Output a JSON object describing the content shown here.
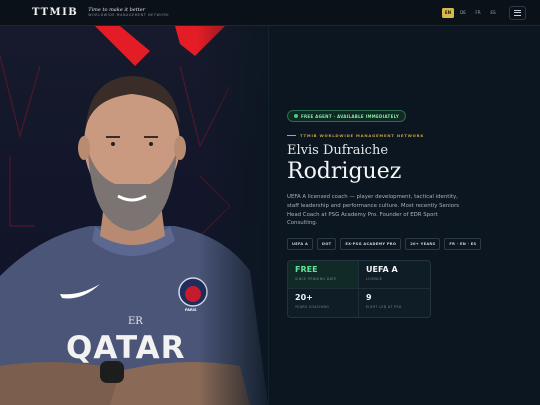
{
  "header": {
    "logo": "TTMIB",
    "tagline_main": "Time to make it better",
    "tagline_sub": "WORLDWIDE MANAGEMENT NETWORK",
    "languages": [
      "EN",
      "DE",
      "FR",
      "ES"
    ],
    "active_language": "EN"
  },
  "colors": {
    "background": "#0b1620",
    "accent_gold": "#d9b84a",
    "accent_green": "#3fd07a"
  },
  "hero": {
    "badge": "FREE AGENT · AVAILABLE IMMEDIATELY",
    "network_label": "TTMIB WORLDWIDE MANAGEMENT NETWORK",
    "first_name": "Elvis Dufraiche",
    "last_name": "Rodriguez",
    "bio": "UEFA A licensed coach — player development, tactical identity, staff leadership and performance culture. Most recently Seniors Head Coach at PSG Academy Pro. Founder of EDR Sport Consulting.",
    "tags": [
      "UEFA A",
      "DOT",
      "EX-PSG ACADEMY PRO",
      "20+ YEARS",
      "FR · EN · ES"
    ],
    "stats": [
      {
        "value": "FREE",
        "label": "SINCE PENDING DATE"
      },
      {
        "value": "UEFA A",
        "label": "LICENCE"
      },
      {
        "value": "20+",
        "label": "YEARS COACHING"
      },
      {
        "value": "9",
        "label": "EIGHT LED AT PSG"
      }
    ]
  },
  "photo": {
    "shirt_text": "QATAR",
    "initials": "ER",
    "crest_text": "PARIS"
  },
  "icons": [
    "menu-icon",
    "status-dot-icon",
    "club-crest-icon",
    "sponsor-logo-icon"
  ]
}
